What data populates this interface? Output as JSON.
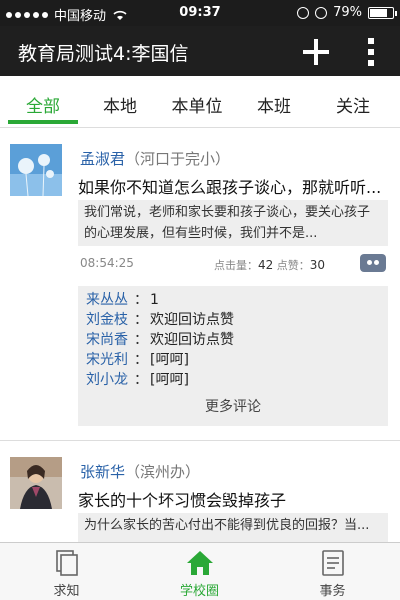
{
  "status_bar": {
    "carrier": "中国移动",
    "time": "09:37",
    "battery": "79%",
    "battery_level": 0.79
  },
  "header": {
    "title": "教育局测试4:李国信",
    "add_icon": "plus-icon",
    "menu_icon": "more-vertical-icon"
  },
  "tabs": [
    {
      "label": "全部",
      "active": true
    },
    {
      "label": "本地"
    },
    {
      "label": "本单位"
    },
    {
      "label": "本班"
    },
    {
      "label": "关注"
    }
  ],
  "posts": [
    {
      "author": "孟淑君",
      "unit": "（河口于完小）",
      "headline": "如果你不知道怎么跟孩子谈心，那就听听...",
      "excerpt": "我们常说，老师和家长要和孩子谈心，要关心孩子的心理发展，但有些时候，我们并不是...",
      "time": "08:54:25",
      "views_label": "点击量：",
      "views": "42",
      "likes_label": "点赞：",
      "likes": "30",
      "comments": [
        {
          "name": "来丛丛",
          "text": "1"
        },
        {
          "name": "刘金枝",
          "text": "欢迎回访点赞"
        },
        {
          "name": "宋尚香",
          "text": "欢迎回访点赞"
        },
        {
          "name": "宋光利",
          "text": "[呵呵]"
        },
        {
          "name": "刘小龙",
          "text": "[呵呵]"
        }
      ],
      "more_comments": "更多评论"
    },
    {
      "author": "张新华",
      "unit": "（滨州办）",
      "headline": "家长的十个坏习惯会毁掉孩子",
      "excerpt": "为什么家长的苦心付出不能得到优良的回报？当..."
    }
  ],
  "bottom_nav": [
    {
      "label": "求知",
      "icon": "document-icon"
    },
    {
      "label": "学校圈",
      "icon": "home-icon",
      "active": true
    },
    {
      "label": "事务",
      "icon": "form-icon"
    }
  ],
  "colors": {
    "accent": "#2aa836",
    "link": "#2a62a8",
    "dark_bar": "#1f1f1f"
  }
}
